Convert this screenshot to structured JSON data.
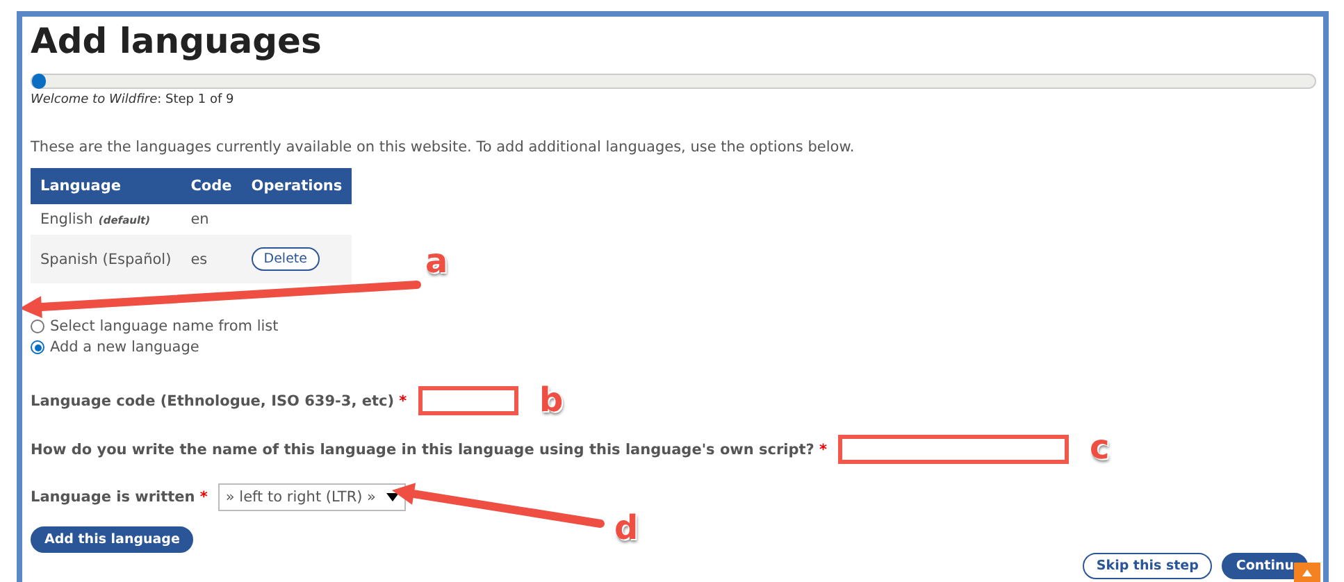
{
  "page": {
    "title": "Add languages"
  },
  "progress": {
    "level": 0,
    "caption_site": "Welcome to Wildfire",
    "caption_step": ": Step 1 of 9"
  },
  "intro": "These are the languages currently available on this website. To add additional languages, use the options below.",
  "table": {
    "columns": [
      "Language",
      "Code",
      "Operations"
    ],
    "rows": [
      {
        "language": "English",
        "note": "(default)",
        "code": "en",
        "operation": null
      },
      {
        "language": "Spanish (Español)",
        "note": null,
        "code": "es",
        "operation": "Delete"
      }
    ]
  },
  "options": [
    {
      "label": "Select language name from list",
      "selected": false
    },
    {
      "label": "Add a new language",
      "selected": true
    }
  ],
  "fields": [
    {
      "kind": "text",
      "label": "Language code (Ethnologue, ISO 639-3, etc)",
      "required_mark": "*",
      "highlighted": true
    },
    {
      "kind": "text",
      "label": "How do you write the name of this language in this language using this language's own script?",
      "required_mark": "*",
      "highlighted": true
    },
    {
      "kind": "select",
      "label": "Language is written",
      "required_mark": "*",
      "value": "» left to right (LTR) »"
    }
  ],
  "submit": "Add this language",
  "footer_buttons": [
    {
      "label": "Skip this step",
      "kind": "outline"
    },
    {
      "label": "Continu",
      "kind": "filled"
    }
  ],
  "annotations": [
    {
      "letter": "a"
    },
    {
      "letter": "b"
    },
    {
      "letter": "c"
    },
    {
      "letter": "d"
    }
  ]
}
